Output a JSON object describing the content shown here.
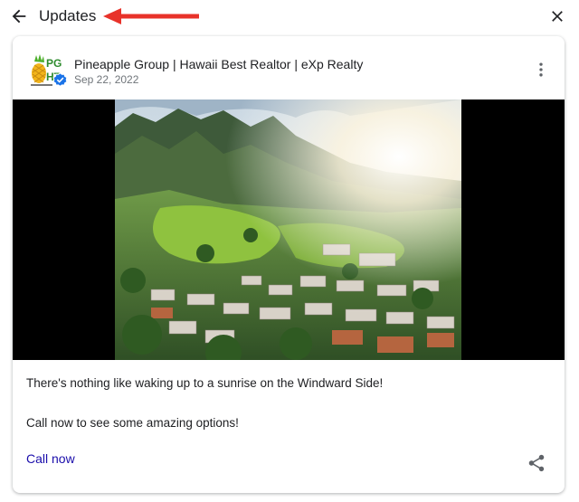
{
  "header": {
    "title": "Updates",
    "back_icon": "arrow-back-icon",
    "close_icon": "close-icon",
    "annotation_color": "#e8322a"
  },
  "post": {
    "author": "Pineapple Group | Hawaii Best Realtor | eXp Realty",
    "date": "Sep 22, 2022",
    "avatar_logo_text": "PG HT",
    "verified_color": "#1a73e8",
    "lines": [
      "There's nothing like waking up to a sunrise on the Windward Side!",
      "Call now to see some amazing options!"
    ],
    "cta_label": "Call now",
    "cta_color": "#1a0dab",
    "more_icon": "more-vert-icon",
    "share_icon": "share-icon",
    "image_description_icon": "photo-windward-sunrise"
  }
}
